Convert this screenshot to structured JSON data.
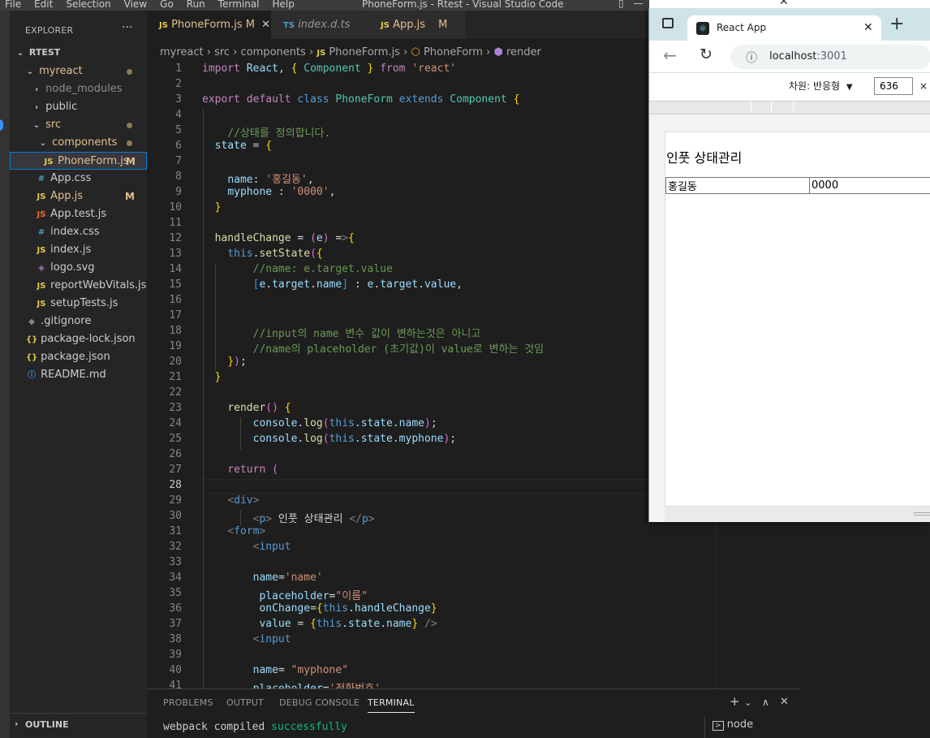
{
  "vscode": {
    "menu": [
      "File",
      "Edit",
      "Selection",
      "View",
      "Go",
      "Run",
      "Terminal",
      "Help"
    ],
    "window_title": "PhoneForm.js - Rtest - Visual Studio Code",
    "explorer": {
      "title": "EXPLORER",
      "root": "RTEST",
      "items": [
        {
          "label": "myreact",
          "icon": "chevron-down-icon",
          "badge": "dot"
        },
        {
          "label": "node_modules",
          "icon": "chevron-right-icon"
        },
        {
          "label": "public",
          "icon": "chevron-right-icon"
        },
        {
          "label": "src",
          "icon": "chevron-down-icon",
          "badge": "dot"
        },
        {
          "label": "components",
          "icon": "chevron-down-icon",
          "badge": "dot"
        },
        {
          "label": "PhoneForm.js",
          "icon": "JS",
          "badge": "M"
        },
        {
          "label": "App.css",
          "icon": "#"
        },
        {
          "label": "App.js",
          "icon": "JS",
          "badge": "M"
        },
        {
          "label": "App.test.js",
          "icon": "JS"
        },
        {
          "label": "index.css",
          "icon": "#"
        },
        {
          "label": "index.js",
          "icon": "JS"
        },
        {
          "label": "logo.svg",
          "icon": "svg-icon"
        },
        {
          "label": "reportWebVitals.js",
          "icon": "JS"
        },
        {
          "label": "setupTests.js",
          "icon": "JS"
        },
        {
          "label": ".gitignore",
          "icon": "git-icon"
        },
        {
          "label": "package-lock.json",
          "icon": "{}"
        },
        {
          "label": "package.json",
          "icon": "{}"
        },
        {
          "label": "README.md",
          "icon": "info-icon"
        }
      ],
      "outline": "OUTLINE"
    },
    "tabs": [
      {
        "label": "PhoneForm.js",
        "prefix": "JS",
        "status": "M",
        "active": true
      },
      {
        "label": "index.d.ts",
        "prefix": "TS"
      },
      {
        "label": "App.js",
        "prefix": "JS",
        "status": "M"
      }
    ],
    "breadcrumb": [
      "myreact",
      "src",
      "components",
      "PhoneForm.js",
      "PhoneForm",
      "render"
    ],
    "current_line": 28,
    "code_lines": [
      "import React, { Component } from 'react'",
      "",
      "export default class PhoneForm extends Component {",
      "",
      "    //상태를 정의합니다.",
      "  state = {",
      "",
      "    name: '홍길동',",
      "    myphone : '0000',",
      "  }",
      "",
      "  handleChange = (e) =>{",
      "    this.setState({",
      "        //name: e.target.value",
      "        [e.target.name] : e.target.value,",
      "",
      "",
      "        //input의 name 변수 값이 변하는것은 아니고",
      "        //name의 placeholder (초기값)이 value로 변하는 것임",
      "    });",
      "  }",
      "",
      "    render() {",
      "        console.log(this.state.name);",
      "        console.log(this.state.myphone);",
      "",
      "    return (",
      "",
      "    <div>",
      "        <p> 인풋 상태관리 </p>",
      "    <form>",
      "        <input",
      "",
      "        name='name'",
      "         placeholder=\"이름\"",
      "         onChange={this.handleChange}",
      "         value = {this.state.name} />",
      "        <input",
      "",
      "        name= \"myphone\"",
      "        placeholder='전화번호'"
    ],
    "panel": {
      "tabs": [
        "PROBLEMS",
        "OUTPUT",
        "DEBUG CONSOLE",
        "TERMINAL"
      ],
      "active_tab": "TERMINAL",
      "terminal_text": "webpack compiled ",
      "terminal_status": "successfully",
      "terminal_name": "node"
    }
  },
  "browser": {
    "tab_title": "React App",
    "url_host": "localhost",
    "url_port": ":3001",
    "dimensions_label": "차원: 반응형",
    "width_value": "636",
    "page_heading": "인풋 상태관리",
    "input_name_value": "홍길동",
    "input_phone_value": "0000"
  }
}
